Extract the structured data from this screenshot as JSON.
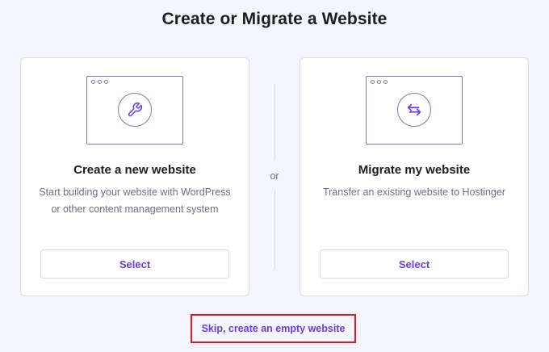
{
  "page": {
    "title": "Create or Migrate a Website"
  },
  "cards": [
    {
      "icon": "wrench-icon",
      "title": "Create a new website",
      "description": "Start building your website with WordPress or other content management system",
      "button_label": "Select"
    },
    {
      "icon": "arrows-swap-icon",
      "title": "Migrate my website",
      "description": "Transfer an existing website to Hostinger",
      "button_label": "Select"
    }
  ],
  "divider": {
    "label": "or"
  },
  "skip": {
    "label": "Skip, create an empty website"
  },
  "colors": {
    "accent": "#673de6",
    "highlight_border": "#e01b1b",
    "background": "#f4f5ff"
  }
}
